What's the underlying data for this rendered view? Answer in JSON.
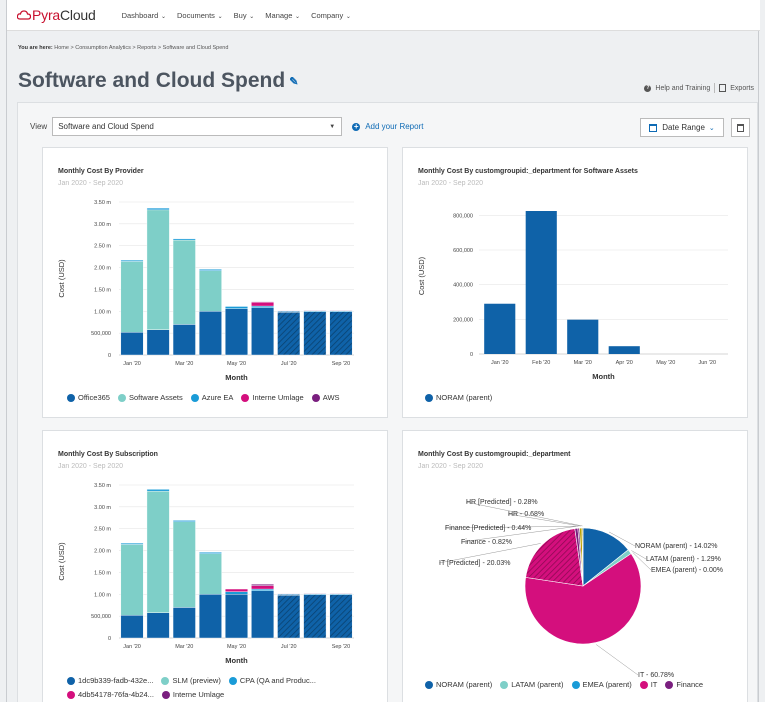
{
  "brand": {
    "name_part1": "Pyra",
    "name_part2": "Cloud"
  },
  "nav": [
    {
      "label": "Dashboard"
    },
    {
      "label": "Documents"
    },
    {
      "label": "Buy"
    },
    {
      "label": "Manage"
    },
    {
      "label": "Company"
    }
  ],
  "breadcrumb": {
    "prefix": "You are here:",
    "path": "Home > Consumption Analytics > Reports > Software and Cloud Spend"
  },
  "page_title": "Software and Cloud Spend",
  "header_links": {
    "help": "Help and Training",
    "exports": "Exports"
  },
  "toolbar": {
    "view_label": "View",
    "view_value": "Software and Cloud Spend",
    "add_report": "Add your Report",
    "date_range": "Date Range"
  },
  "colors": {
    "office365": "#0f62a8",
    "software_assets": "#7ecfc8",
    "azure_ea": "#1a9bd7",
    "interne_umlage": "#d40f7d",
    "aws": "#7a1f7f",
    "finance": "#7a1f7f"
  },
  "card1": {
    "title": "Monthly Cost By Provider",
    "subtitle": "Jan 2020 - Sep 2020"
  },
  "card2": {
    "title": "Monthly Cost By customgroupid:_department for Software Assets",
    "subtitle": "Jan 2020 - Sep 2020"
  },
  "card3": {
    "title": "Monthly Cost By Subscription",
    "subtitle": "Jan 2020 - Sep 2020"
  },
  "card4": {
    "title": "Monthly Cost By customgroupid:_department",
    "subtitle": "Jan 2020 - Sep 2020"
  },
  "chart_data": [
    {
      "id": "provider",
      "type": "bar",
      "stacked": true,
      "xlabel": "Month",
      "ylabel": "Cost (USD)",
      "categories": [
        "Jan '20",
        "Feb '20",
        "Mar '20",
        "Apr '20",
        "May '20",
        "Jun '20",
        "Jul '20",
        "Aug '20",
        "Sep '20"
      ],
      "x_tick_labels": [
        "Jan '20",
        "Mar '20",
        "May '20",
        "Jul '20",
        "Sep '20"
      ],
      "y_ticks": [
        0,
        500000,
        1000000,
        1500000,
        2000000,
        2500000,
        3000000,
        3500000
      ],
      "y_tick_labels": [
        "0",
        "500,000",
        "1.00 m",
        "1.50 m",
        "2.00 m",
        "2.50 m",
        "3.00 m",
        "3.50 m"
      ],
      "ylim": [
        0,
        3500000
      ],
      "predicted_from_index": 6,
      "series": [
        {
          "name": "Office365",
          "values": [
            520000,
            580000,
            700000,
            1000000,
            1060000,
            1080000,
            980000,
            990000,
            990000
          ]
        },
        {
          "name": "Software Assets",
          "values": [
            1620000,
            2740000,
            1930000,
            930000,
            0,
            0,
            0,
            0,
            0
          ]
        },
        {
          "name": "Azure EA",
          "values": [
            30000,
            40000,
            30000,
            30000,
            50000,
            40000,
            20000,
            20000,
            20000
          ]
        },
        {
          "name": "Interne Umlage",
          "values": [
            0,
            0,
            0,
            0,
            0,
            90000,
            0,
            0,
            0
          ]
        },
        {
          "name": "AWS",
          "values": [
            0,
            0,
            0,
            0,
            0,
            10000,
            10000,
            10000,
            10000
          ]
        }
      ]
    },
    {
      "id": "department_software_assets",
      "type": "bar",
      "xlabel": "Month",
      "ylabel": "Cost (USD)",
      "categories": [
        "Jan '20",
        "Feb '20",
        "Mar '20",
        "Apr '20",
        "May '20",
        "Jun '20"
      ],
      "y_ticks": [
        0,
        200000,
        400000,
        600000,
        800000
      ],
      "y_tick_labels": [
        "0",
        "200,000",
        "400,000",
        "600,000",
        "800,000"
      ],
      "ylim": [
        0,
        900000
      ],
      "series": [
        {
          "name": "NORAM (parent)",
          "values": [
            290000,
            825000,
            198000,
            45000,
            0,
            0
          ]
        }
      ]
    },
    {
      "id": "subscription",
      "type": "bar",
      "stacked": true,
      "xlabel": "Month",
      "ylabel": "Cost (USD)",
      "categories": [
        "Jan '20",
        "Feb '20",
        "Mar '20",
        "Apr '20",
        "May '20",
        "Jun '20",
        "Jul '20",
        "Aug '20",
        "Sep '20"
      ],
      "x_tick_labels": [
        "Jan '20",
        "Mar '20",
        "May '20",
        "Jul '20",
        "Sep '20"
      ],
      "y_ticks": [
        0,
        500000,
        1000000,
        1500000,
        2000000,
        2500000,
        3000000,
        3500000
      ],
      "y_tick_labels": [
        "0",
        "500,000",
        "1.00 m",
        "1.50 m",
        "2.00 m",
        "2.50 m",
        "3.00 m",
        "3.50 m"
      ],
      "ylim": [
        0,
        3500000
      ],
      "predicted_from_index": 6,
      "series": [
        {
          "name": "1dc9b339-fadb-432e...",
          "values": [
            520000,
            580000,
            700000,
            1000000,
            1000000,
            1080000,
            980000,
            990000,
            990000
          ]
        },
        {
          "name": "SLM (preview)",
          "values": [
            1620000,
            2780000,
            1960000,
            930000,
            0,
            0,
            0,
            0,
            0
          ]
        },
        {
          "name": "CPA (QA and Produc...",
          "values": [
            30000,
            40000,
            30000,
            30000,
            60000,
            40000,
            20000,
            20000,
            20000
          ]
        },
        {
          "name": "4db54178-76fa-4b24...",
          "values": [
            0,
            0,
            0,
            0,
            60000,
            80000,
            0,
            0,
            0
          ]
        },
        {
          "name": "Interne Umlage",
          "values": [
            0,
            0,
            0,
            0,
            0,
            30000,
            10000,
            10000,
            10000
          ]
        }
      ]
    },
    {
      "id": "department",
      "type": "pie",
      "slices": [
        {
          "label": "NORAM (parent) - 14.02%",
          "name": "NORAM (parent)",
          "value": 14.02
        },
        {
          "label": "LATAM (parent) - 1.29%",
          "name": "LATAM (parent)",
          "value": 1.29
        },
        {
          "label": "EMEA (parent) - 0.00%",
          "name": "EMEA (parent)",
          "value": 0.0
        },
        {
          "label": "IT - 60.78%",
          "name": "IT",
          "value": 60.78
        },
        {
          "label": "IT [Predicted] - 20.03%",
          "name": "IT [Predicted]",
          "value": 20.03
        },
        {
          "label": "Finance - 0.82%",
          "name": "Finance",
          "value": 0.82
        },
        {
          "label": "Finance [Predicted] - 0.44%",
          "name": "Finance [Predicted]",
          "value": 0.44
        },
        {
          "label": "HR - 0.68%",
          "name": "HR",
          "value": 0.68
        },
        {
          "label": "HR [Predicted] - 0.28%",
          "name": "HR [Predicted]",
          "value": 0.28
        }
      ],
      "legend": [
        "NORAM (parent)",
        "LATAM (parent)",
        "EMEA (parent)",
        "IT",
        "Finance"
      ]
    }
  ]
}
